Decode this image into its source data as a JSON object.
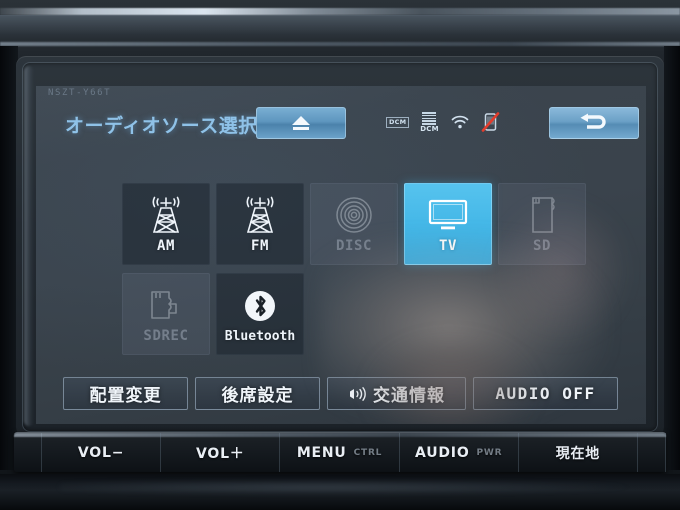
{
  "device": {
    "model_number": "NSZT-Y66T"
  },
  "screen": {
    "title": "オーディオソース選択",
    "eject_button": {
      "name": "eject",
      "icon": "eject-icon"
    },
    "back_button": {
      "name": "back",
      "icon": "return-arrow-icon"
    },
    "status_icons": [
      {
        "name": "dcm-badge-icon",
        "label": "DCM"
      },
      {
        "name": "dcm-signal-icon",
        "label": "DCM"
      },
      {
        "name": "wifi-icon",
        "label": ""
      },
      {
        "name": "phone-disconnected-icon",
        "label": ""
      }
    ]
  },
  "sources": [
    {
      "label": "AM",
      "icon": "radio-tower-icon",
      "state": "enabled"
    },
    {
      "label": "FM",
      "icon": "radio-tower-icon",
      "state": "enabled"
    },
    {
      "label": "DISC",
      "icon": "disc-icon",
      "state": "disabled"
    },
    {
      "label": "TV",
      "icon": "tv-monitor-icon",
      "state": "selected"
    },
    {
      "label": "SD",
      "icon": "sd-card-icon",
      "state": "disabled"
    },
    {
      "label": "SDREC",
      "icon": "sd-record-icon",
      "state": "disabled"
    },
    {
      "label": "Bluetooth",
      "icon": "bluetooth-icon",
      "state": "enabled"
    }
  ],
  "function_buttons": [
    {
      "label": "配置変更",
      "icon": null
    },
    {
      "label": "後席設定",
      "icon": null
    },
    {
      "label": "交通情報",
      "icon": "broadcast-wave-icon"
    },
    {
      "label": "AUDIO OFF",
      "icon": null
    }
  ],
  "hardware_buttons": [
    {
      "label": "VOL−",
      "sub": ""
    },
    {
      "label": "VOL＋",
      "sub": ""
    },
    {
      "label": "MENU",
      "sub": "CTRL"
    },
    {
      "label": "AUDIO",
      "sub": "PWR"
    },
    {
      "label": "現在地",
      "sub": ""
    }
  ],
  "colors": {
    "accent_selected": "#41b5e6",
    "title_text": "#8fc2e8",
    "screen_bg": "#3a434c",
    "button_blue": "#6ba0c6"
  }
}
